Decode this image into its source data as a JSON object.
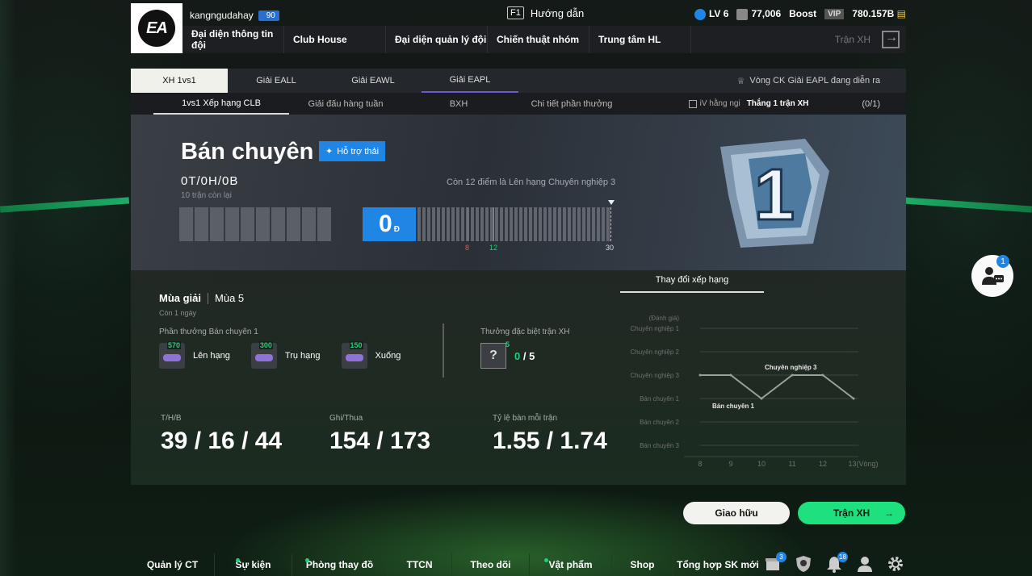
{
  "header": {
    "username": "kangngudahay",
    "user_level_badge": "90",
    "guide_key": "F1",
    "guide_label": "Hướng dẫn",
    "level": "LV 6",
    "coins": "77,006",
    "boost_label": "Boost",
    "vip_label": "VIP",
    "bp": "780.157B",
    "nav": [
      "Đại diện thông tin đội",
      "Club House",
      "Đại diện quản lý đội",
      "Chiến thuật nhóm",
      "Trung tâm HL"
    ],
    "nav_right": "Trận XH"
  },
  "tabs_main": [
    "XH 1vs1",
    "Giải EALL",
    "Giải EAWL",
    "Giải EAPL"
  ],
  "tabs_main_notice": "Vòng CK Giải EAPL đang diễn ra",
  "tabs_sub": [
    "1vs1 Xếp hạng CLB",
    "Giải đấu hàng tuần",
    "BXH",
    "Chi tiết phần thưởng"
  ],
  "mission": {
    "label": "iV hằng ngi",
    "task": "Thắng 1 trận XH",
    "progress": "(0/1)"
  },
  "rank": {
    "title": "Bán chuyên 1",
    "support_label": "Hỗ trợ thải",
    "record": "0T/0H/0B",
    "remaining": "10 trận còn lại",
    "promo_text": "Còn 12 điểm là Lên hạng Chuyên nghiệp 3",
    "score": "0",
    "score_unit": "Đ",
    "tick_red": "8",
    "tick_green": "12",
    "tick_end": "30",
    "emblem_number": "1"
  },
  "season": {
    "label": "Mùa giải",
    "name": "Mùa 5",
    "remaining": "Còn 1 ngày",
    "reward_title": "Phần thưởng Bán chuyên 1",
    "rewards": [
      {
        "amount": "570",
        "label": "Lên hạng"
      },
      {
        "amount": "300",
        "label": "Trụ hạng"
      },
      {
        "amount": "150",
        "label": "Xuống"
      }
    ],
    "special_title": "Thưởng đặc biệt trận XH",
    "special_badge": "5",
    "special_count": "0",
    "special_total": "/ 5"
  },
  "stats": {
    "whl_label": "T/H/B",
    "whl_value": "39 / 16 / 44",
    "goals_label": "Ghi/Thua",
    "goals_value": "154 / 173",
    "ratio_label": "Tỷ lệ bàn mỗi trận",
    "ratio_value": "1.55 / 1.74"
  },
  "chart_data": {
    "type": "line",
    "title": "Thay đổi xếp hạng",
    "ylabel": "(Đánh giá)",
    "xlabel": "(Vòng)",
    "y_categories": [
      "Chuyên nghiệp 1",
      "Chuyên nghiệp 2",
      "Chuyên nghiệp 3",
      "Bán chuyên 1",
      "Bán chuyên 2",
      "Bán chuyên 3"
    ],
    "x": [
      8,
      9,
      10,
      11,
      12,
      13
    ],
    "series": [
      {
        "values": [
          "Chuyên nghiệp 3",
          "Chuyên nghiệp 3",
          "Bán chuyên 1",
          "Chuyên nghiệp 3",
          "Chuyên nghiệp 3",
          "Bán chuyên 1"
        ]
      }
    ],
    "annotations": [
      "Chuyên nghiệp 3",
      "Bán chuyên 1"
    ]
  },
  "buttons": {
    "friendly": "Giao hữu",
    "ranked": "Trận XH"
  },
  "chat_badge": "1",
  "bottom_nav": [
    "Quản lý CT",
    "Sự kiện",
    "Phòng thay đồ",
    "TTCN",
    "Theo dõi",
    "Vật phẩm",
    "Shop",
    "Tổng hợp SK mới"
  ],
  "bottom_badges": {
    "events": "3",
    "notifications": "18"
  },
  "colors": {
    "accent_blue": "#1f86e6",
    "accent_green": "#1fe07e",
    "tick_red": "#e0584a"
  }
}
